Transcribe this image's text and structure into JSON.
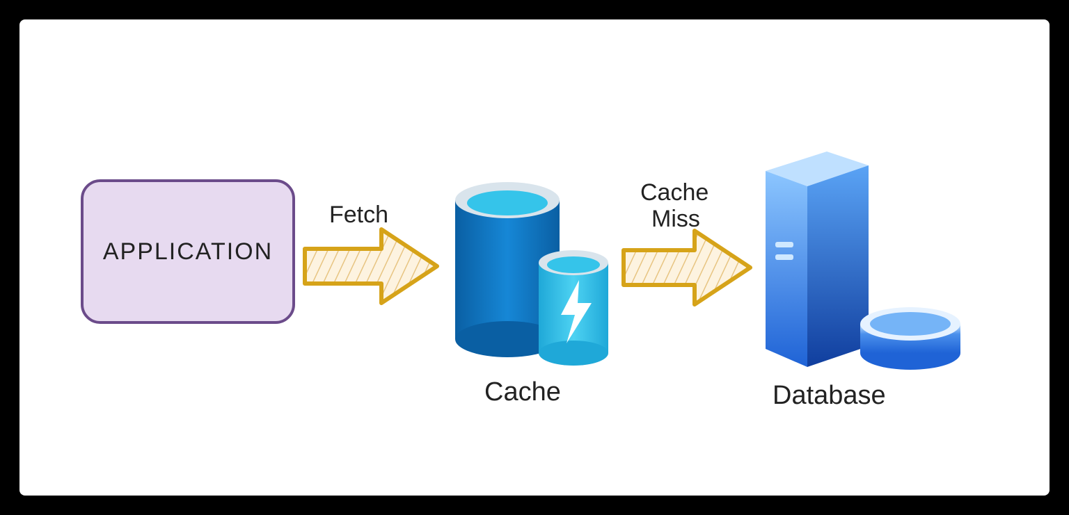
{
  "nodes": {
    "application": {
      "label": "APPLICATION"
    },
    "cache": {
      "label": "Cache"
    },
    "database": {
      "label": "Database"
    }
  },
  "edges": {
    "fetch": {
      "label": "Fetch"
    },
    "cacheMiss": {
      "line1": "Cache",
      "line2": "Miss"
    }
  },
  "colors": {
    "appFill": "#e7daf0",
    "appStroke": "#6b4b8a",
    "arrowStroke": "#d6a319",
    "arrowFill": "#fdf3e0",
    "cachePrimary": "#0f79c4",
    "cacheAccent": "#35c4ea",
    "dbBlueDark": "#2360d6",
    "dbBlueLight": "#5aa3f5"
  }
}
